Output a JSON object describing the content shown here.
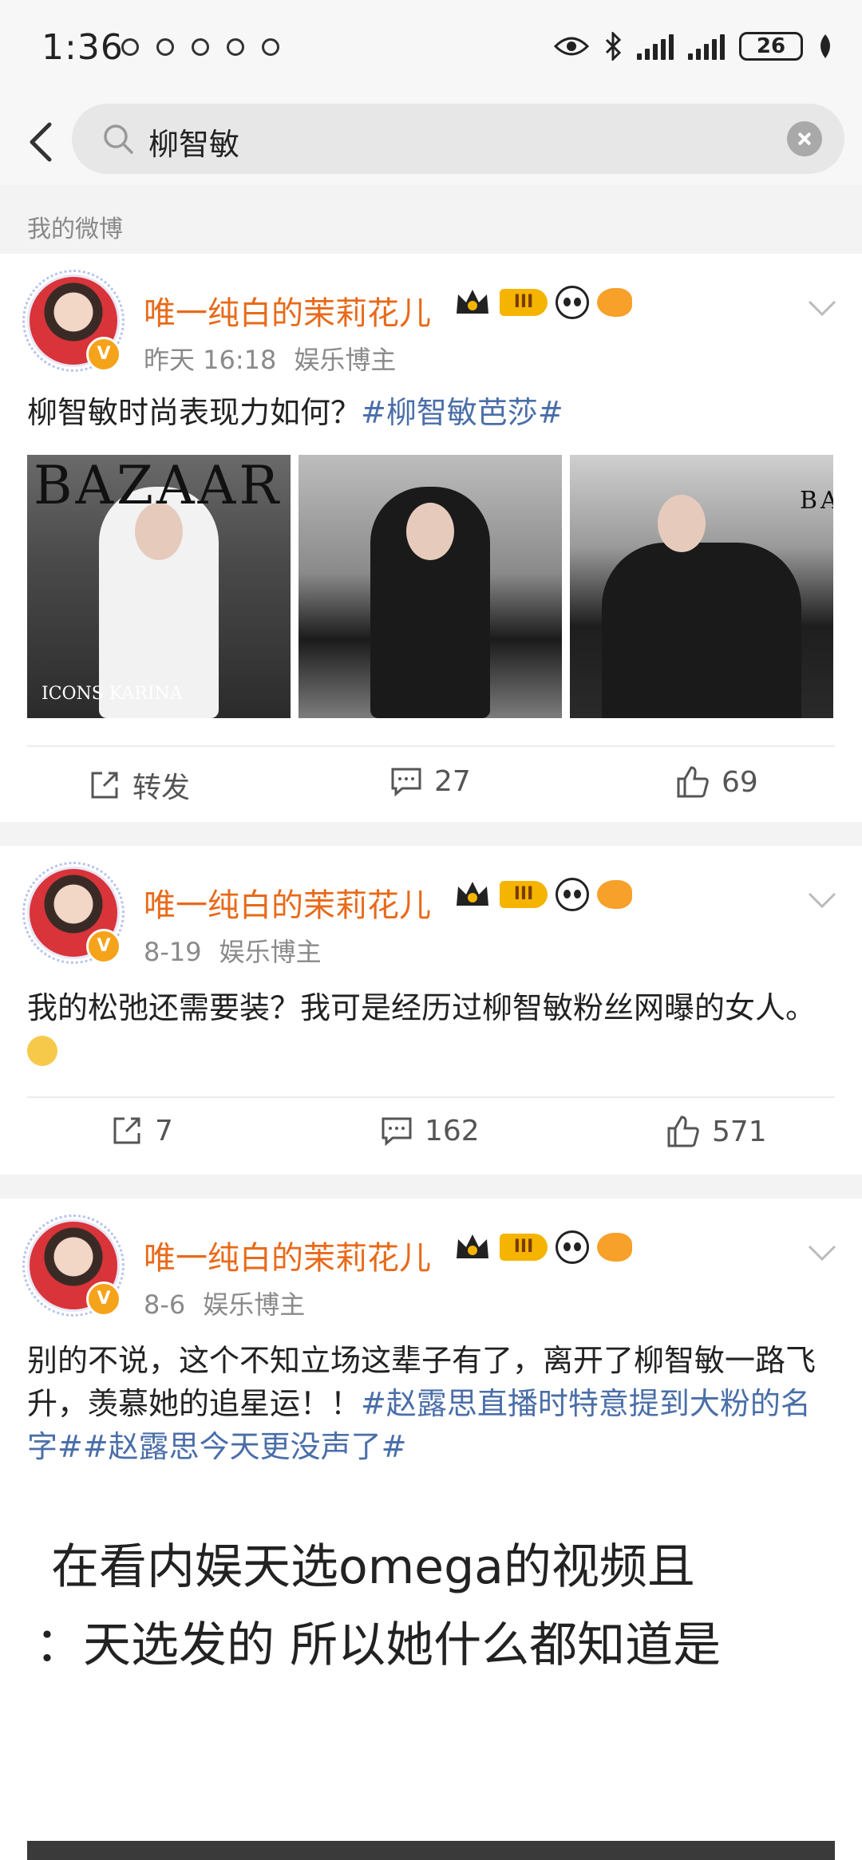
{
  "status_bar": {
    "time": "1:36",
    "battery": "26"
  },
  "search": {
    "query": "柳智敏"
  },
  "section": {
    "label": "我的微博"
  },
  "posts": [
    {
      "author": "唯一纯白的茉莉花儿",
      "level": "III",
      "time": "昨天 16:18",
      "source": "娱乐博主",
      "text": "柳智敏时尚表现力如何？",
      "tags": "#柳智敏芭莎#",
      "images": [
        {
          "title": "BAZAAR",
          "subtitle": "ICONS KARINA"
        },
        {
          "title": "",
          "subtitle": ""
        },
        {
          "title": "BA",
          "subtitle": ""
        }
      ],
      "repost": "转发",
      "comments": "27",
      "likes": "69"
    },
    {
      "author": "唯一纯白的茉莉花儿",
      "level": "III",
      "time": "8-19",
      "source": "娱乐博主",
      "text": "我的松弛还需要装？我可是经历过柳智敏粉丝网曝的女人。",
      "tags": "",
      "repost": "7",
      "comments": "162",
      "likes": "571"
    },
    {
      "author": "唯一纯白的茉莉花儿",
      "level": "III",
      "time": "8-6",
      "source": "娱乐博主",
      "text": "别的不说，这个不知立场这辈子有了，离开了柳智敏一路飞升，羡慕她的追星运！！",
      "tags": "#赵露思直播时特意提到大粉的名字##赵露思今天更没声了#",
      "video_lines": [
        "在看内娱天选omega的视频且",
        "：天选发的 所以她什么都知道是"
      ]
    }
  ],
  "colors": {
    "name": "#e86a1a",
    "tag": "#4a6ea8",
    "meta": "#8a8a8a"
  }
}
